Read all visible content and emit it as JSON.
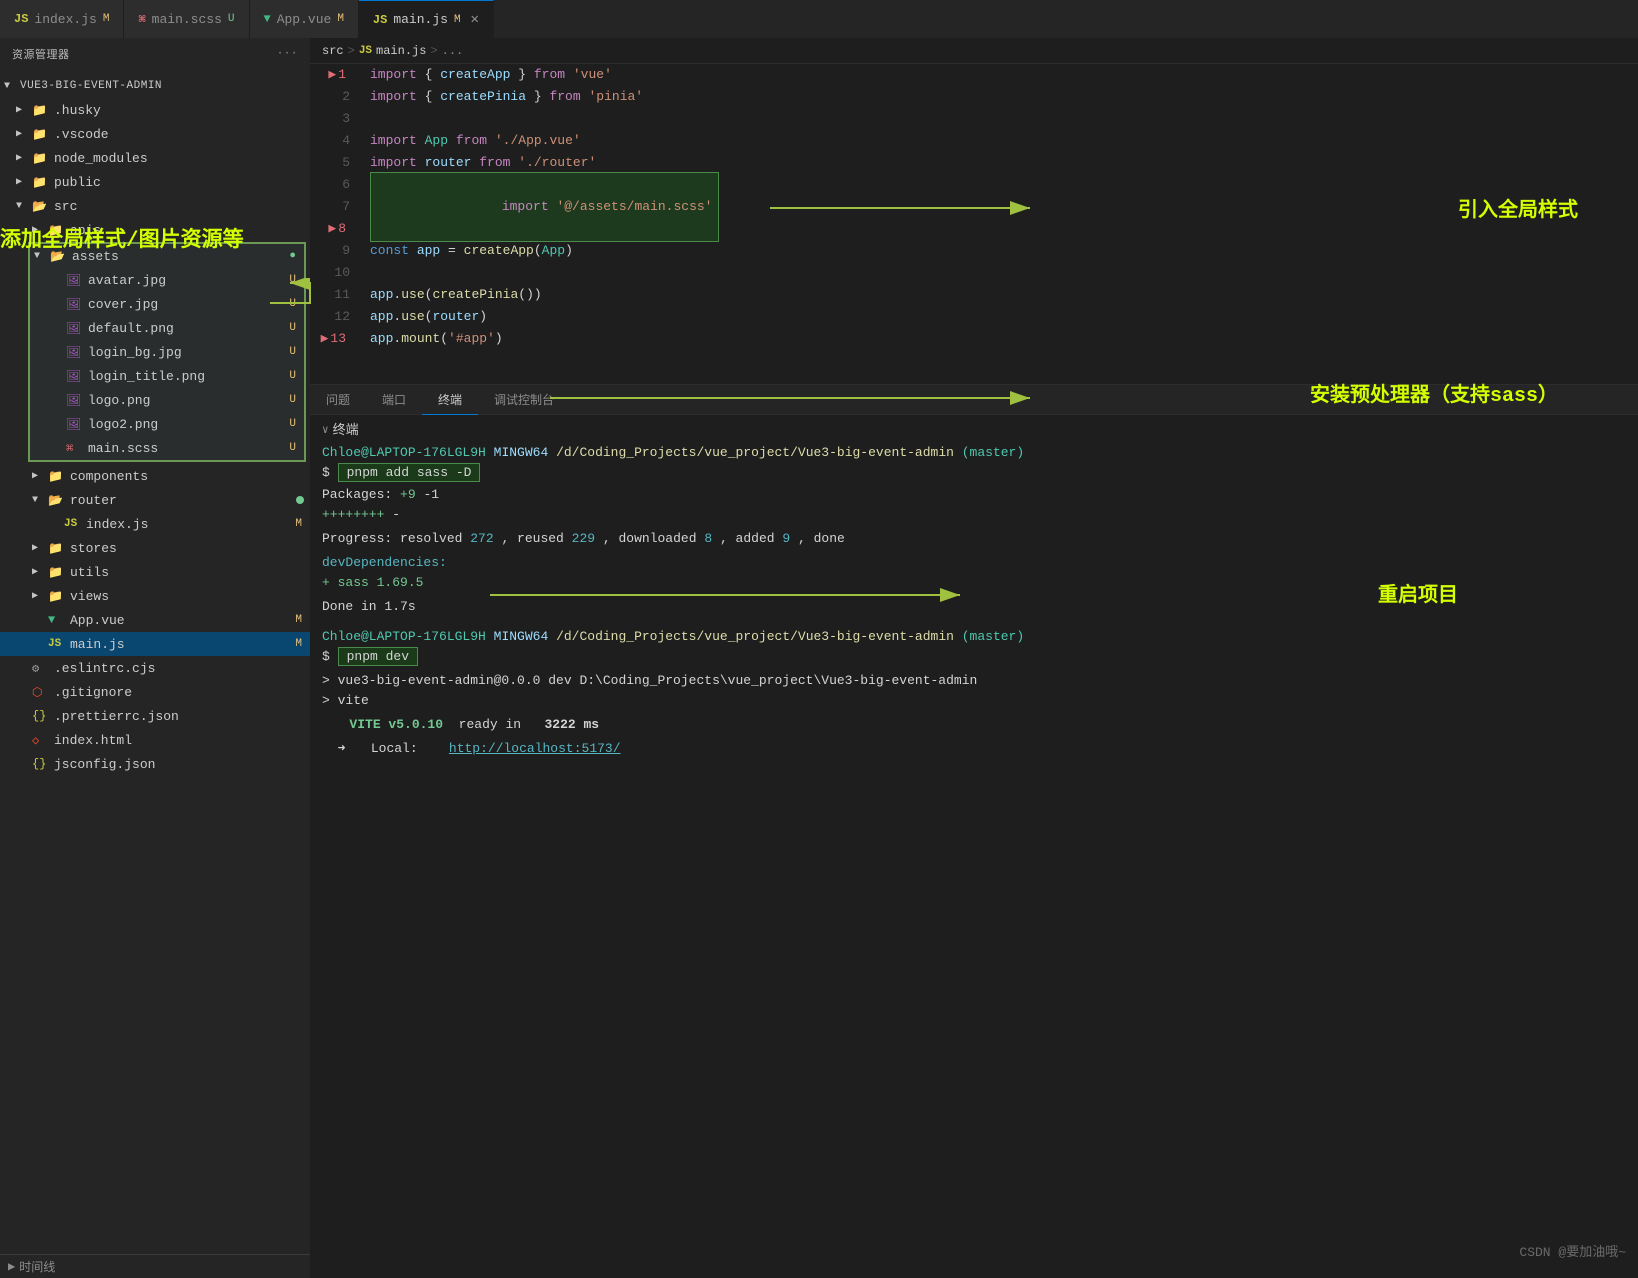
{
  "tabs": [
    {
      "id": "index-js",
      "icon": "JS",
      "icon_type": "js",
      "label": "index.js",
      "badge": "M",
      "active": false
    },
    {
      "id": "main-scss",
      "icon": "⌘",
      "icon_type": "css",
      "label": "main.scss",
      "badge": "U",
      "active": false
    },
    {
      "id": "app-vue",
      "icon": "▼",
      "icon_type": "vue",
      "label": "App.vue",
      "badge": "M",
      "active": false
    },
    {
      "id": "main-js-2",
      "icon": "JS",
      "icon_type": "js",
      "label": "main.js",
      "badge": "M",
      "active": true,
      "closable": true
    }
  ],
  "breadcrumb": {
    "parts": [
      "src",
      ">",
      "JS",
      "main.js",
      ">",
      "..."
    ]
  },
  "code": {
    "lines": [
      {
        "num": 1,
        "arrow": true,
        "content": "import { createApp } from 'vue'"
      },
      {
        "num": 2,
        "arrow": false,
        "content": "import { createPinia } from 'pinia'"
      },
      {
        "num": 3,
        "arrow": false,
        "content": ""
      },
      {
        "num": 4,
        "arrow": false,
        "content": "import App from './App.vue'"
      },
      {
        "num": 5,
        "arrow": false,
        "content": "import router from './router'"
      },
      {
        "num": 6,
        "arrow": false,
        "content": ""
      },
      {
        "num": 7,
        "arrow": false,
        "content": "import '@/assets/main.scss'",
        "highlighted": true
      },
      {
        "num": 8,
        "arrow": true,
        "content": ""
      },
      {
        "num": 9,
        "arrow": false,
        "content": "const app = createApp(App)"
      },
      {
        "num": 10,
        "arrow": false,
        "content": ""
      },
      {
        "num": 11,
        "arrow": false,
        "content": "app.use(createPinia())"
      },
      {
        "num": 12,
        "arrow": false,
        "content": "app.use(router)"
      },
      {
        "num": 13,
        "arrow": true,
        "content": "app.mount('#app')"
      }
    ]
  },
  "sidebar": {
    "title": "资源管理器",
    "root_label": "VUE3-BIG-EVENT-ADMIN",
    "items": [
      {
        "label": ".husky",
        "type": "folder",
        "indent": 1,
        "collapsed": true
      },
      {
        "label": ".vscode",
        "type": "folder",
        "indent": 1,
        "collapsed": true
      },
      {
        "label": "node_modules",
        "type": "folder",
        "indent": 1,
        "collapsed": true
      },
      {
        "label": "public",
        "type": "folder",
        "indent": 1,
        "collapsed": true
      },
      {
        "label": "src",
        "type": "folder",
        "indent": 1,
        "collapsed": false
      },
      {
        "label": "apis",
        "type": "folder",
        "indent": 2,
        "collapsed": true
      },
      {
        "label": "assets",
        "type": "folder",
        "indent": 2,
        "collapsed": false,
        "badge_green": true
      },
      {
        "label": "avatar.jpg",
        "type": "img",
        "indent": 3,
        "badge": "U"
      },
      {
        "label": "cover.jpg",
        "type": "img",
        "indent": 3,
        "badge": "U"
      },
      {
        "label": "default.png",
        "type": "img",
        "indent": 3,
        "badge": "U"
      },
      {
        "label": "login_bg.jpg",
        "type": "img",
        "indent": 3,
        "badge": "U"
      },
      {
        "label": "login_title.png",
        "type": "img",
        "indent": 3,
        "badge": "U"
      },
      {
        "label": "logo.png",
        "type": "img",
        "indent": 3,
        "badge": "U"
      },
      {
        "label": "logo2.png",
        "type": "img",
        "indent": 3,
        "badge": "U"
      },
      {
        "label": "main.scss",
        "type": "css",
        "indent": 3,
        "badge": "U"
      },
      {
        "label": "components",
        "type": "folder",
        "indent": 2,
        "collapsed": true
      },
      {
        "label": "router",
        "type": "folder",
        "indent": 2,
        "collapsed": false,
        "badge_dot": true
      },
      {
        "label": "index.js",
        "type": "js",
        "indent": 3,
        "badge": "M"
      },
      {
        "label": "stores",
        "type": "folder",
        "indent": 2,
        "collapsed": true
      },
      {
        "label": "utils",
        "type": "folder",
        "indent": 2,
        "collapsed": true
      },
      {
        "label": "views",
        "type": "folder",
        "indent": 2,
        "collapsed": true
      },
      {
        "label": "App.vue",
        "type": "vue",
        "indent": 2,
        "badge": "M"
      },
      {
        "label": "main.js",
        "type": "js",
        "indent": 2,
        "badge": "M",
        "active": true
      },
      {
        "label": ".eslintrc.cjs",
        "type": "dot",
        "indent": 1
      },
      {
        "label": ".gitignore",
        "type": "dot",
        "indent": 1
      },
      {
        "label": ".prettierrc.json",
        "type": "json-dot",
        "indent": 1
      },
      {
        "label": "index.html",
        "type": "html",
        "indent": 1
      },
      {
        "label": "jsconfig.json",
        "type": "json",
        "indent": 1
      }
    ]
  },
  "panel": {
    "tabs": [
      "问题",
      "端口",
      "终端",
      "调试控制台"
    ],
    "active_tab": "终端",
    "terminal_label": "终端",
    "sections": [
      {
        "prompt_user": "Chloe@LAPTOP-176LGL9H",
        "prompt_mingw": "MINGW64",
        "prompt_path": "/d/Coding_Projects/vue_project/Vue3-big-event-admin",
        "prompt_branch": "(master)",
        "command": "pnpm add sass -D",
        "output": [
          "Packages: +9 -1",
          "++++++++-",
          "",
          "Progress: resolved 272, reused 229, downloaded 8, added 9, done",
          "",
          "devDependencies:",
          "+ sass 1.69.5",
          "",
          "Done in 1.7s"
        ]
      },
      {
        "prompt_user": "Chloe@LAPTOP-176LGL9H",
        "prompt_mingw": "MINGW64",
        "prompt_path": "/d/Coding_Projects/vue_project/Vue3-big-event-admin",
        "prompt_branch": "(master)",
        "command": "pnpm dev",
        "output": [
          "",
          "> vue3-big-event-admin@0.0.0 dev D:\\Coding_Projects\\vue_project\\Vue3-big-event-admin",
          "> vite",
          "",
          "  VITE v5.0.10  ready in  3222 ms",
          "",
          "  ➜  Local:   http://localhost:5173/"
        ]
      }
    ]
  },
  "annotations": {
    "left": "添加全局样式/图片资源等",
    "right": "引入全局样式",
    "sass": "安装预处理器（支持sass）",
    "restart": "重启项目"
  },
  "status_bar": {
    "right": "CSDN @要加油哦~"
  },
  "timeline": {
    "label": "时间线"
  }
}
